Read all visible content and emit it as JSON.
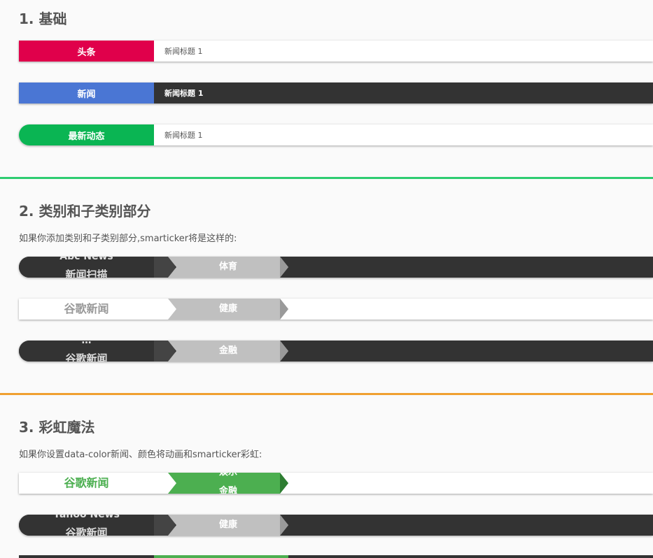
{
  "colors": {
    "red": "#e0004b",
    "blue": "#4a76d4",
    "green": "#0ab553",
    "dark": "#333333",
    "gray_tab": "#c0c0c0",
    "rainbow_green": "#4caf50",
    "divider_green": "#2ecc71",
    "divider_orange": "#f0a030"
  },
  "section1": {
    "title": "1. 基础",
    "tickers": [
      {
        "label": "头条",
        "headline": "新闻标题 1"
      },
      {
        "label": "新闻",
        "headline": "新闻标题 1"
      },
      {
        "label": "最新动态",
        "headline": "新闻标题 1"
      }
    ]
  },
  "section2": {
    "title": "2. 类别和子类别部分",
    "desc": "如果你添加类别和子类别部分,smarticker将是这样的:",
    "tickers": [
      {
        "source_top": "Abc News",
        "source_bottom": "新闻扫描",
        "category": "体育"
      },
      {
        "source": "谷歌新闻",
        "category": "健康"
      },
      {
        "source_top": "…",
        "source_bottom": "谷歌新闻",
        "category": "金融"
      }
    ]
  },
  "section3": {
    "title": "3. 彩虹魔法",
    "desc": "如果你设置data-color新闻、颜色将动画和smarticker彩虹:",
    "tickers": [
      {
        "source": "谷歌新闻",
        "category_top": "娱乐",
        "category_bottom": "金融"
      },
      {
        "source_top": "Yahoo News",
        "source_bottom": "谷歌新闻",
        "category": "健康"
      }
    ]
  }
}
